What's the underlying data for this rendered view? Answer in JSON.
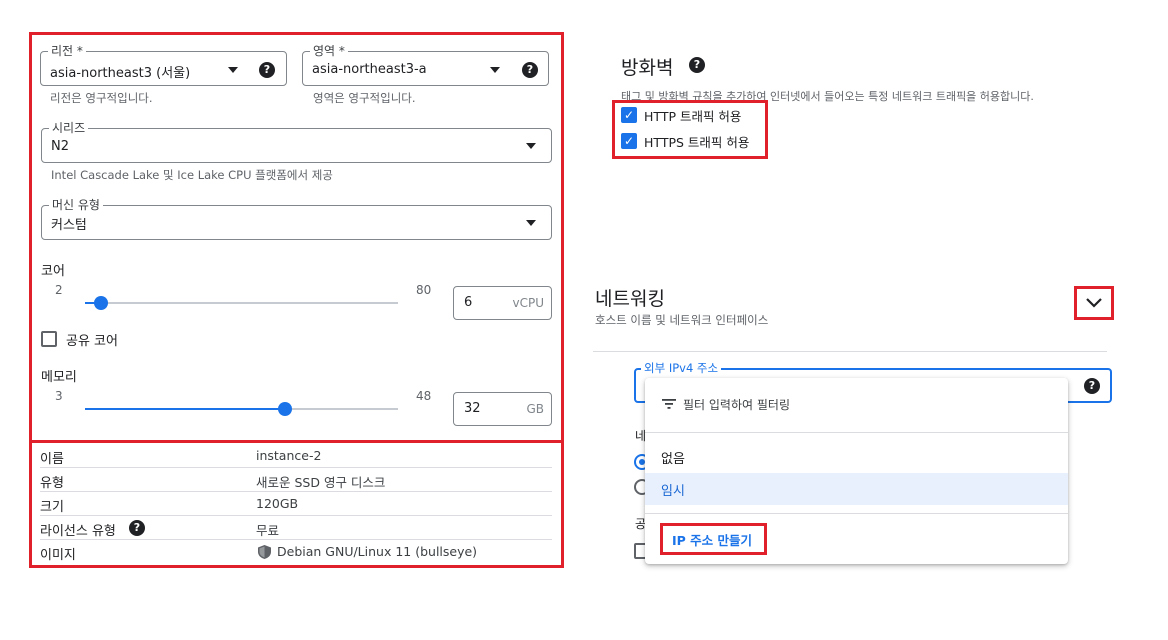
{
  "machine": {
    "region": {
      "label": "리전 *",
      "value": "asia-northeast3 (서울)",
      "hint": "리전은 영구적입니다."
    },
    "zone": {
      "label": "영역 *",
      "value": "asia-northeast3-a",
      "hint": "영역은 영구적입니다."
    },
    "series": {
      "label": "시리즈",
      "value": "N2",
      "hint": "Intel Cascade Lake 및 Ice Lake CPU 플랫폼에서 제공"
    },
    "machine_type": {
      "label": "머신 유형",
      "value": "커스텀"
    },
    "cores": {
      "label": "코어",
      "min": "2",
      "max": "80",
      "value": "6",
      "unit": "vCPU",
      "slider_fraction": 0.05
    },
    "shared_core": {
      "label": "공유 코어",
      "checked": false
    },
    "memory": {
      "label": "메모리",
      "min": "3",
      "max": "48",
      "value": "32",
      "unit": "GB",
      "slider_fraction": 0.64
    }
  },
  "disk_info": {
    "rows": [
      {
        "key": "이름",
        "value": "instance-2"
      },
      {
        "key": "유형",
        "value": "새로운 SSD 영구 디스크"
      },
      {
        "key": "크기",
        "value": "120GB"
      },
      {
        "key": "라이선스 유형",
        "value": "무료"
      },
      {
        "key": "이미지",
        "value": "Debian GNU/Linux 11 (bullseye)"
      }
    ]
  },
  "firewall": {
    "title": "방화벽",
    "description": "태그 및 방화벽 규칙을 추가하여 인터넷에서 들어오는 특정 네트워크 트래픽을 허용합니다.",
    "http_label": "HTTP 트래픽 허용",
    "https_label": "HTTPS 트래픽 허용",
    "http_checked": true,
    "https_checked": true
  },
  "networking": {
    "title": "네트워킹",
    "subtitle": "호스트 이름 및 네트워크 인터페이스",
    "external_ip_label": "외부 IPv4 주소",
    "partial_label_1": "네",
    "partial_label_2": "공"
  },
  "dropdown": {
    "filter_placeholder": "필터 입력하여 필터링",
    "options": [
      "없음",
      "임시"
    ],
    "selected_index": 1,
    "create_ip_label": "IP 주소 만들기"
  },
  "colors": {
    "highlight": "#e0202a",
    "accent": "#1a73e8"
  }
}
